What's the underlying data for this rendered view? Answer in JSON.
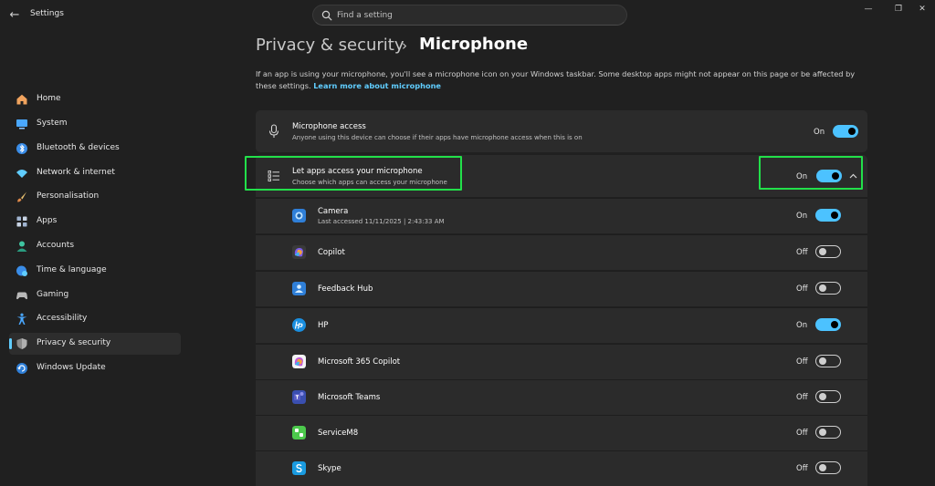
{
  "window": {
    "app_title": "Settings",
    "back_icon": "arrow-left-icon",
    "search_placeholder": "Find a setting",
    "controls": [
      "minimize",
      "maximize",
      "close"
    ]
  },
  "sidebar": {
    "items": [
      {
        "label": "Home",
        "icon": "home-icon",
        "color": "#f0a35e"
      },
      {
        "label": "System",
        "icon": "monitor-icon",
        "color": "#4aa8ff"
      },
      {
        "label": "Bluetooth & devices",
        "icon": "bluetooth-icon",
        "color": "#4aa8ff"
      },
      {
        "label": "Network & internet",
        "icon": "wifi-icon",
        "color": "#60cdff"
      },
      {
        "label": "Personalisation",
        "icon": "brush-icon",
        "color": "#e08a4a"
      },
      {
        "label": "Apps",
        "icon": "apps-icon",
        "color": "#a0b4d0"
      },
      {
        "label": "Accounts",
        "icon": "person-icon",
        "color": "#3fc4a0"
      },
      {
        "label": "Time & language",
        "icon": "globe-clock-icon",
        "color": "#4aa8ff"
      },
      {
        "label": "Gaming",
        "icon": "gamepad-icon",
        "color": "#b8b8b8"
      },
      {
        "label": "Accessibility",
        "icon": "accessibility-icon",
        "color": "#4aa8ff"
      },
      {
        "label": "Privacy & security",
        "icon": "shield-icon",
        "color": "#9a9a9a",
        "selected": true
      },
      {
        "label": "Windows Update",
        "icon": "update-icon",
        "color": "#4aa8ff"
      }
    ]
  },
  "header": {
    "parent": "Privacy & security",
    "title": "Microphone"
  },
  "description": {
    "text": "If an app is using your microphone, you'll see a microphone icon on your Windows taskbar. Some desktop apps might not appear on this page or be affected by these settings.",
    "link": "Learn more about microphone"
  },
  "microphone_access": {
    "title": "Microphone access",
    "subtitle": "Anyone using this device can choose if their apps have microphone access when this is on",
    "state": "On",
    "icon": "microphone-icon"
  },
  "let_apps": {
    "title": "Let apps access your microphone",
    "subtitle": "Choose which apps can access your microphone",
    "state": "On",
    "icon": "list-icon"
  },
  "apps": [
    {
      "name": "Camera",
      "sub": "Last accessed 11/11/2025  |  2:43:33 AM",
      "state": "On",
      "on": true,
      "icon": "camera-icon",
      "color": "#2f7fd8"
    },
    {
      "name": "Copilot",
      "sub": "",
      "state": "Off",
      "on": false,
      "icon": "copilot-icon",
      "color": "#7a5cf0"
    },
    {
      "name": "Feedback Hub",
      "sub": "",
      "state": "Off",
      "on": false,
      "icon": "feedback-hub-icon",
      "color": "#2f7fd8"
    },
    {
      "name": "HP",
      "sub": "",
      "state": "On",
      "on": true,
      "icon": "hp-logo-icon",
      "color": "#1a8fe0"
    },
    {
      "name": "Microsoft 365 Copilot",
      "sub": "",
      "state": "Off",
      "on": false,
      "icon": "m365-copilot-icon",
      "color": "#c05ad8"
    },
    {
      "name": "Microsoft Teams",
      "sub": "",
      "state": "Off",
      "on": false,
      "icon": "teams-icon",
      "color": "#5b5fc7"
    },
    {
      "name": "ServiceM8",
      "sub": "",
      "state": "Off",
      "on": false,
      "icon": "servicem8-icon",
      "color": "#4cc94c"
    },
    {
      "name": "Skype",
      "sub": "",
      "state": "Off",
      "on": false,
      "icon": "skype-icon",
      "color": "#1a9be0"
    }
  ],
  "colors": {
    "accent": "#4cc2ff",
    "highlight": "#22e04a",
    "background": "#202020",
    "card": "#2b2b2b"
  }
}
